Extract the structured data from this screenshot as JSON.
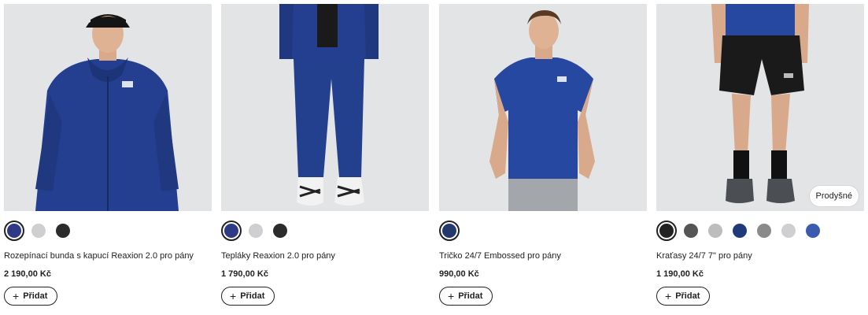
{
  "products": [
    {
      "name": "Rozepínací bunda s kapucí Reaxion 2.0 pro pány",
      "price": "2 190,00 Kč",
      "add_label": "Přidat",
      "swatches": [
        "#2f3a86",
        "#cfcfd1",
        "#2b2b2b"
      ],
      "selected_swatch": 0,
      "badge": ""
    },
    {
      "name": "Tepláky Reaxion 2.0 pro pány",
      "price": "1 790,00 Kč",
      "add_label": "Přidat",
      "swatches": [
        "#2f3a86",
        "#cfcfd1",
        "#2b2b2b"
      ],
      "selected_swatch": 0,
      "badge": ""
    },
    {
      "name": "Tričko 24/7 Embossed pro pány",
      "price": "990,00 Kč",
      "add_label": "Přidat",
      "swatches": [
        "#223a6e"
      ],
      "selected_swatch": 0,
      "badge": ""
    },
    {
      "name": "Kraťasy 24/7 7\" pro pány",
      "price": "1 190,00 Kč",
      "add_label": "Přidat",
      "swatches": [
        "#222222",
        "#555555",
        "#bdbdbd",
        "#1f3a78",
        "#8a8a8a",
        "#cfcfd1",
        "#3b5bb0"
      ],
      "selected_swatch": 0,
      "badge": "Prodyšné"
    }
  ]
}
